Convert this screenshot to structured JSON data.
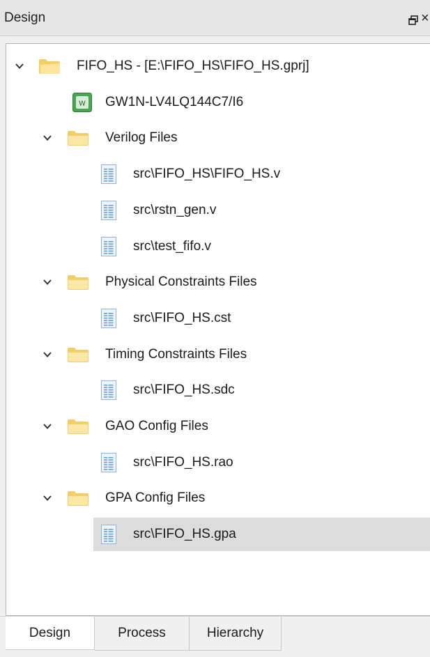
{
  "window": {
    "title": "Design",
    "float_glyph": "restore-window",
    "close_glyph": "×"
  },
  "tree": {
    "project": {
      "label": "FIFO_HS - [E:\\FIFO_HS\\FIFO_HS.gprj]",
      "device": "GW1N-LV4LQ144C7/I6"
    },
    "groups": [
      {
        "label": "Verilog Files",
        "files": [
          "src\\FIFO_HS\\FIFO_HS.v",
          "src\\rstn_gen.v",
          "src\\test_fifo.v"
        ]
      },
      {
        "label": "Physical Constraints Files",
        "files": [
          "src\\FIFO_HS.cst"
        ]
      },
      {
        "label": "Timing Constraints Files",
        "files": [
          "src\\FIFO_HS.sdc"
        ]
      },
      {
        "label": "GAO Config Files",
        "files": [
          "src\\FIFO_HS.rao"
        ]
      },
      {
        "label": "GPA Config Files",
        "files": [
          "src\\FIFO_HS.gpa"
        ]
      }
    ],
    "selected_file": "src\\FIFO_HS.gpa"
  },
  "tabs": [
    {
      "label": "Design",
      "active": true
    },
    {
      "label": "Process",
      "active": false
    },
    {
      "label": "Hierarchy",
      "active": false
    }
  ],
  "colors": {
    "folder": "#f3cd67",
    "folder_light": "#fbe7a6",
    "selection": "#dcdcdc",
    "file_icon": "#6a9fd8"
  }
}
